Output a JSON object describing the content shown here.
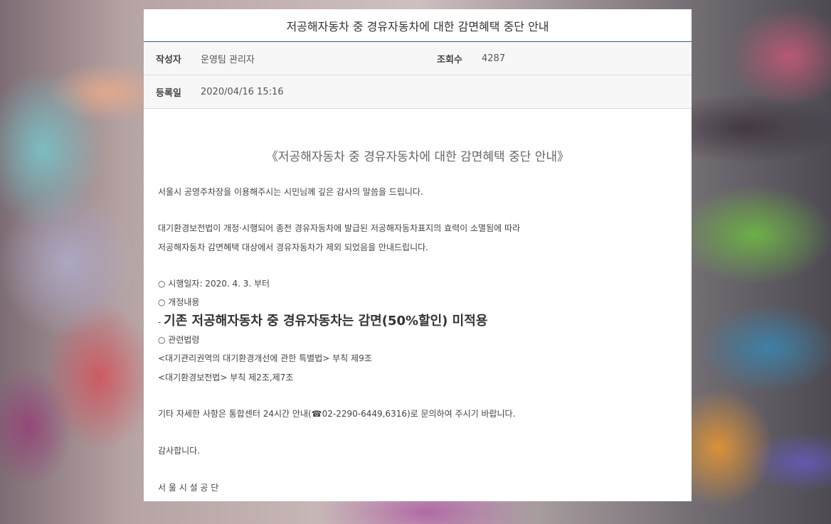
{
  "header": {
    "title": "저공해자동차 중 경유자동차에 대한 감면혜택 중단 안내"
  },
  "meta": {
    "author_label": "작성자",
    "author_value": "운영팀 관리자",
    "views_label": "조회수",
    "views_value": "4287",
    "date_label": "등록일",
    "date_value": "2020/04/16 15:16"
  },
  "body": {
    "heading": "《저공해자동차 중 경유자동차에 대한 감면혜택 중단 안내》",
    "greeting": "서울시 공영주차장을 이용해주시는 시민님께 깊은 감사의 말씀을 드립니다.",
    "para1_line1": "대기환경보전법이 개정·시행되어 종전 경유자동차에 발급된 저공해자동차표지의 효력이 소멸됨에 따라",
    "para1_line2": "저공해자동차 감면혜택 대상에서 경유자동차가 제외 되었음을 안내드립니다.",
    "effective_date": "○ 시행일자: 2020. 4. 3. 부터",
    "revision_label": "○ 개정내용",
    "revision_dash": "- ",
    "revision_text": "기존 저공해자동차 중 경유자동차는 감면(50%할인) 미적용",
    "laws_label": "○ 관련법령",
    "law1": "<대기관리권역의 대기환경개선에 관한 특별법> 부칙 제9조",
    "law2": "<대기환경보전법> 부칙 제2조,제7조",
    "contact": "기타 자세한 사항은 통합센터 24시간 안내(☎02-2290-6449,6316)로 문의하여 주시기 바랍니다.",
    "thanks": "감사합니다.",
    "signature": "서 울 시 설 공 단"
  }
}
